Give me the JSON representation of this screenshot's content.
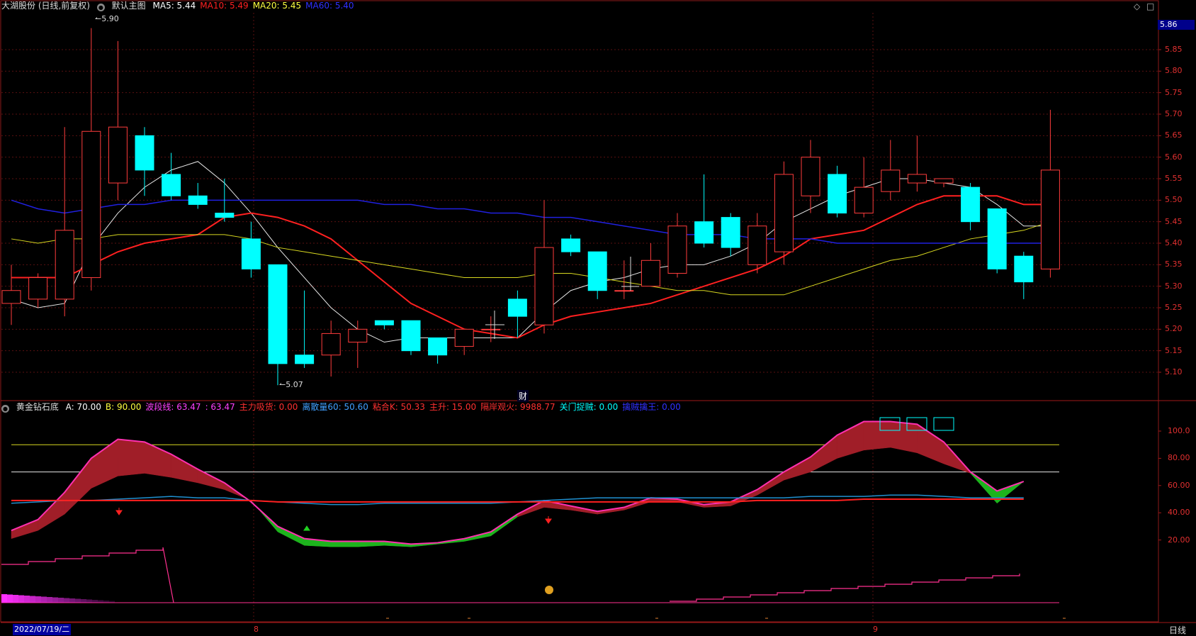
{
  "header": {
    "title": "大湖股份 (日线,前复权)",
    "main_chart_label": "默认主图",
    "ma": [
      {
        "label": "MA5:",
        "value": "5.44",
        "color": "#ffffff"
      },
      {
        "label": "MA10:",
        "value": "5.49",
        "color": "#ff2020"
      },
      {
        "label": "MA20:",
        "value": "5.45",
        "color": "#ffff40"
      },
      {
        "label": "MA60:",
        "value": "5.40",
        "color": "#3030ff"
      }
    ]
  },
  "current_price_tag": "5.86",
  "main_axis": {
    "ticks": [
      "5.85",
      "5.80",
      "5.75",
      "5.70",
      "5.65",
      "5.60",
      "5.55",
      "5.50",
      "5.45",
      "5.40",
      "5.35",
      "5.30",
      "5.25",
      "5.20",
      "5.15",
      "5.10"
    ],
    "high_label": "5.90",
    "low_label": "5.07",
    "event_marker": "财"
  },
  "indicator": {
    "name": "黄金钻石底",
    "items": [
      {
        "label": "A:",
        "value": "70.00",
        "color": "#ffffff"
      },
      {
        "label": "B:",
        "value": "90.00",
        "color": "#ffff40"
      },
      {
        "label": "波段线:",
        "value": "63.47",
        "color": "#ff40ff"
      },
      {
        "label": ":",
        "value": "63.47",
        "color": "#ff40ff"
      },
      {
        "label": "主力吸货:",
        "value": "0.00",
        "color": "#ff3030"
      },
      {
        "label": "离散量60:",
        "value": "50.60",
        "color": "#40a0ff"
      },
      {
        "label": "粘合K:",
        "value": "50.33",
        "color": "#ff3030"
      },
      {
        "label": "主升:",
        "value": "15.00",
        "color": "#ff3030"
      },
      {
        "label": "隔岸观火:",
        "value": "9988.77",
        "color": "#ff3030"
      },
      {
        "label": "关门捉贼:",
        "value": "0.00",
        "color": "#00ffff"
      },
      {
        "label": "擒贼擒王:",
        "value": "0.00",
        "color": "#3030ff"
      }
    ],
    "axis_ticks": [
      "100.0",
      "80.00",
      "60.00",
      "40.00",
      "20.00"
    ]
  },
  "bottom": {
    "date": "2022/07/19/二",
    "months": [
      "8",
      "9"
    ],
    "period": "日线"
  },
  "candles": [
    {
      "o": 5.26,
      "c": 5.29,
      "h": 5.35,
      "l": 5.21
    },
    {
      "o": 5.27,
      "c": 5.32,
      "h": 5.33,
      "l": 5.25
    },
    {
      "o": 5.27,
      "c": 5.43,
      "h": 5.67,
      "l": 5.23
    },
    {
      "o": 5.32,
      "c": 5.66,
      "h": 5.9,
      "l": 5.29
    },
    {
      "o": 5.54,
      "c": 5.67,
      "h": 5.87,
      "l": 5.5
    },
    {
      "o": 5.65,
      "c": 5.57,
      "h": 5.67,
      "l": 5.51
    },
    {
      "o": 5.56,
      "c": 5.51,
      "h": 5.61,
      "l": 5.5
    },
    {
      "o": 5.51,
      "c": 5.49,
      "h": 5.54,
      "l": 5.48
    },
    {
      "o": 5.47,
      "c": 5.46,
      "h": 5.55,
      "l": 5.45
    },
    {
      "o": 5.41,
      "c": 5.34,
      "h": 5.45,
      "l": 5.32
    },
    {
      "o": 5.35,
      "c": 5.12,
      "h": 5.35,
      "l": 5.07
    },
    {
      "o": 5.14,
      "c": 5.12,
      "h": 5.29,
      "l": 5.11
    },
    {
      "o": 5.14,
      "c": 5.19,
      "h": 5.22,
      "l": 5.09
    },
    {
      "o": 5.17,
      "c": 5.2,
      "h": 5.22,
      "l": 5.11
    },
    {
      "o": 5.22,
      "c": 5.21,
      "h": 5.22,
      "l": 5.2
    },
    {
      "o": 5.22,
      "c": 5.15,
      "h": 5.22,
      "l": 5.14
    },
    {
      "o": 5.18,
      "c": 5.14,
      "h": 5.18,
      "l": 5.12
    },
    {
      "o": 5.16,
      "c": 5.2,
      "h": 5.2,
      "l": 5.14
    },
    {
      "o": 5.2,
      "c": 5.2,
      "h": 5.23,
      "l": 5.17
    },
    {
      "o": 5.27,
      "c": 5.23,
      "h": 5.29,
      "l": 5.18
    },
    {
      "o": 5.21,
      "c": 5.39,
      "h": 5.5,
      "l": 5.19
    },
    {
      "o": 5.41,
      "c": 5.38,
      "h": 5.42,
      "l": 5.37
    },
    {
      "o": 5.38,
      "c": 5.29,
      "h": 5.38,
      "l": 5.27
    },
    {
      "o": 5.29,
      "c": 5.29,
      "h": 5.36,
      "l": 5.27
    },
    {
      "o": 5.3,
      "c": 5.36,
      "h": 5.4,
      "l": 5.3
    },
    {
      "o": 5.33,
      "c": 5.44,
      "h": 5.47,
      "l": 5.32
    },
    {
      "o": 5.45,
      "c": 5.4,
      "h": 5.56,
      "l": 5.39
    },
    {
      "o": 5.46,
      "c": 5.39,
      "h": 5.47,
      "l": 5.37
    },
    {
      "o": 5.35,
      "c": 5.44,
      "h": 5.47,
      "l": 5.33
    },
    {
      "o": 5.38,
      "c": 5.56,
      "h": 5.59,
      "l": 5.35
    },
    {
      "o": 5.51,
      "c": 5.6,
      "h": 5.64,
      "l": 5.47
    },
    {
      "o": 5.56,
      "c": 5.47,
      "h": 5.58,
      "l": 5.46
    },
    {
      "o": 5.47,
      "c": 5.53,
      "h": 5.6,
      "l": 5.46
    },
    {
      "o": 5.52,
      "c": 5.57,
      "h": 5.64,
      "l": 5.5
    },
    {
      "o": 5.54,
      "c": 5.56,
      "h": 5.65,
      "l": 5.52
    },
    {
      "o": 5.54,
      "c": 5.55,
      "h": 5.55,
      "l": 5.53
    },
    {
      "o": 5.53,
      "c": 5.45,
      "h": 5.54,
      "l": 5.43
    },
    {
      "o": 5.48,
      "c": 5.34,
      "h": 5.48,
      "l": 5.33
    },
    {
      "o": 5.37,
      "c": 5.31,
      "h": 5.38,
      "l": 5.27
    },
    {
      "o": 5.34,
      "c": 5.57,
      "h": 5.71,
      "l": 5.32
    }
  ],
  "ma_series": {
    "ma5": [
      5.27,
      5.25,
      5.26,
      5.39,
      5.47,
      5.53,
      5.57,
      5.59,
      5.54,
      5.47,
      5.39,
      5.32,
      5.25,
      5.2,
      5.17,
      5.18,
      5.18,
      5.18,
      5.18,
      5.18,
      5.24,
      5.29,
      5.31,
      5.32,
      5.34,
      5.35,
      5.35,
      5.37,
      5.4,
      5.45,
      5.48,
      5.51,
      5.53,
      5.55,
      5.55,
      5.54,
      5.53,
      5.49,
      5.44,
      5.44
    ],
    "ma10": [
      5.32,
      5.32,
      5.32,
      5.35,
      5.38,
      5.4,
      5.41,
      5.42,
      5.46,
      5.47,
      5.46,
      5.44,
      5.41,
      5.36,
      5.31,
      5.26,
      5.23,
      5.2,
      5.19,
      5.18,
      5.21,
      5.23,
      5.24,
      5.25,
      5.26,
      5.28,
      5.3,
      5.32,
      5.34,
      5.37,
      5.41,
      5.42,
      5.43,
      5.46,
      5.49,
      5.51,
      5.51,
      5.51,
      5.49,
      5.49
    ],
    "ma20": [
      5.41,
      5.4,
      5.41,
      5.41,
      5.42,
      5.42,
      5.42,
      5.42,
      5.42,
      5.41,
      5.39,
      5.38,
      5.37,
      5.36,
      5.35,
      5.34,
      5.33,
      5.32,
      5.32,
      5.32,
      5.33,
      5.33,
      5.32,
      5.31,
      5.3,
      5.29,
      5.29,
      5.28,
      5.28,
      5.28,
      5.3,
      5.32,
      5.34,
      5.36,
      5.37,
      5.39,
      5.41,
      5.42,
      5.43,
      5.45
    ],
    "ma60": [
      5.5,
      5.48,
      5.47,
      5.48,
      5.49,
      5.49,
      5.5,
      5.5,
      5.5,
      5.5,
      5.5,
      5.5,
      5.5,
      5.5,
      5.49,
      5.49,
      5.48,
      5.48,
      5.47,
      5.47,
      5.46,
      5.46,
      5.45,
      5.44,
      5.43,
      5.42,
      5.42,
      5.42,
      5.41,
      5.41,
      5.41,
      5.4,
      5.4,
      5.4,
      5.4,
      5.4,
      5.4,
      5.4,
      5.4,
      5.4
    ]
  },
  "indicator_series": {
    "band_top": [
      27,
      35,
      55,
      80,
      94,
      92,
      83,
      72,
      62,
      48,
      30,
      21,
      19,
      19,
      19,
      17,
      18,
      21,
      26,
      39,
      49,
      45,
      41,
      44,
      51,
      50,
      46,
      48,
      57,
      70,
      81,
      97,
      107,
      107,
      105,
      92,
      70,
      56,
      63
    ],
    "band_bot": [
      21,
      27,
      39,
      58,
      67,
      69,
      66,
      62,
      57,
      49,
      26,
      16,
      15,
      15,
      16,
      15,
      17,
      19,
      23,
      37,
      44,
      42,
      39,
      42,
      48,
      48,
      44,
      45,
      53,
      64,
      70,
      80,
      86,
      88,
      84,
      76,
      69,
      47,
      63
    ],
    "disc60": [
      47,
      48,
      49,
      49,
      50,
      51,
      52,
      51,
      51,
      49,
      48,
      47,
      46,
      46,
      47,
      47,
      47,
      47,
      47,
      48,
      49,
      50,
      51,
      51,
      51,
      51,
      51,
      51,
      51,
      51,
      52,
      52,
      52,
      53,
      53,
      52,
      51,
      51,
      51
    ],
    "red_line": [
      49,
      49,
      49,
      49,
      49,
      49,
      49,
      49,
      49,
      49,
      48,
      48,
      48,
      48,
      48,
      48,
      48,
      48,
      48,
      48,
      48,
      48,
      48,
      48,
      48,
      48,
      48,
      48,
      49,
      49,
      49,
      49,
      50,
      50,
      50,
      50,
      50,
      50,
      50
    ]
  }
}
